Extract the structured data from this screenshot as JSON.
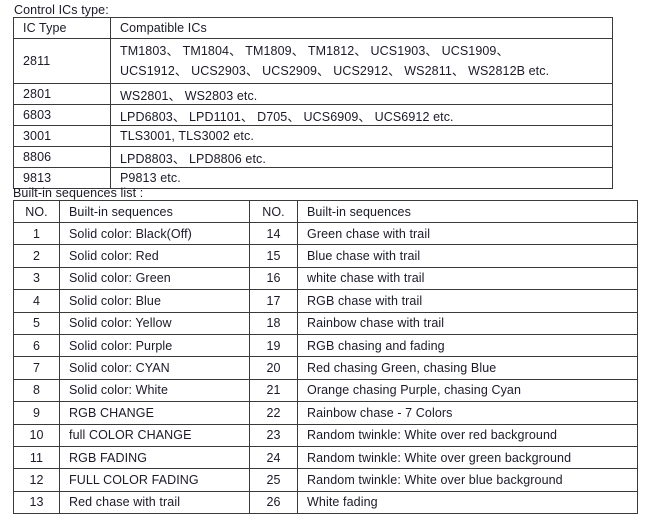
{
  "captions": {
    "ic_types": "Control ICs type:",
    "sequences": "Built-in sequences list :"
  },
  "ic_table": {
    "headers": [
      "IC Type",
      "Compatible ICs"
    ],
    "rows": [
      {
        "type": "2811",
        "lines": [
          "TM1803、 TM1804、 TM1809、 TM1812、 UCS1903、 UCS1909、",
          "UCS1912、 UCS2903、 UCS2909、 UCS2912、 WS2811、 WS2812B etc."
        ]
      },
      {
        "type": "2801",
        "lines": [
          "WS2801、 WS2803 etc."
        ]
      },
      {
        "type": "6803",
        "lines": [
          "LPD6803、 LPD1101、 D705、 UCS6909、 UCS6912 etc."
        ]
      },
      {
        "type": "3001",
        "lines": [
          "TLS3001, TLS3002 etc."
        ]
      },
      {
        "type": "8806",
        "lines": [
          "LPD8803、 LPD8806 etc."
        ]
      },
      {
        "type": "9813",
        "lines": [
          "P9813 etc."
        ]
      }
    ]
  },
  "sequence_table": {
    "headers": [
      "NO.",
      "Built-in sequences",
      "NO.",
      "Built-in sequences"
    ],
    "rows": [
      {
        "no_left": "1",
        "seq_left": "Solid color: Black(Off)",
        "no_right": "14",
        "seq_right": "Green chase with trail"
      },
      {
        "no_left": "2",
        "seq_left": "Solid color: Red",
        "no_right": "15",
        "seq_right": "Blue chase with trail"
      },
      {
        "no_left": "3",
        "seq_left": "Solid color: Green",
        "no_right": "16",
        "seq_right": "white chase with trail"
      },
      {
        "no_left": "4",
        "seq_left": "Solid color: Blue",
        "no_right": "17",
        "seq_right": "RGB chase with trail"
      },
      {
        "no_left": "5",
        "seq_left": "Solid color: Yellow",
        "no_right": "18",
        "seq_right": "Rainbow chase with trail"
      },
      {
        "no_left": "6",
        "seq_left": "Solid color: Purple",
        "no_right": "19",
        "seq_right": "RGB chasing and fading"
      },
      {
        "no_left": "7",
        "seq_left": "Solid color: CYAN",
        "no_right": "20",
        "seq_right": "Red chasing Green, chasing Blue"
      },
      {
        "no_left": "8",
        "seq_left": "Solid color: White",
        "no_right": "21",
        "seq_right": "Orange chasing Purple, chasing Cyan"
      },
      {
        "no_left": "9",
        "seq_left": "RGB CHANGE",
        "no_right": "22",
        "seq_right": "Rainbow chase - 7 Colors"
      },
      {
        "no_left": "10",
        "seq_left": "full COLOR CHANGE",
        "no_right": "23",
        "seq_right": "Random twinkle: White over red background"
      },
      {
        "no_left": "11",
        "seq_left": "RGB FADING",
        "no_right": "24",
        "seq_right": "Random twinkle: White over green background"
      },
      {
        "no_left": "12",
        "seq_left": "FULL COLOR FADING",
        "no_right": "25",
        "seq_right": "Random twinkle: White over blue background"
      },
      {
        "no_left": "13",
        "seq_left": "Red chase with trail",
        "no_right": "26",
        "seq_right": "White fading"
      }
    ]
  },
  "colors": {
    "text": "#1a1a28",
    "border": "#3a3a3a",
    "background": "#ffffff"
  }
}
